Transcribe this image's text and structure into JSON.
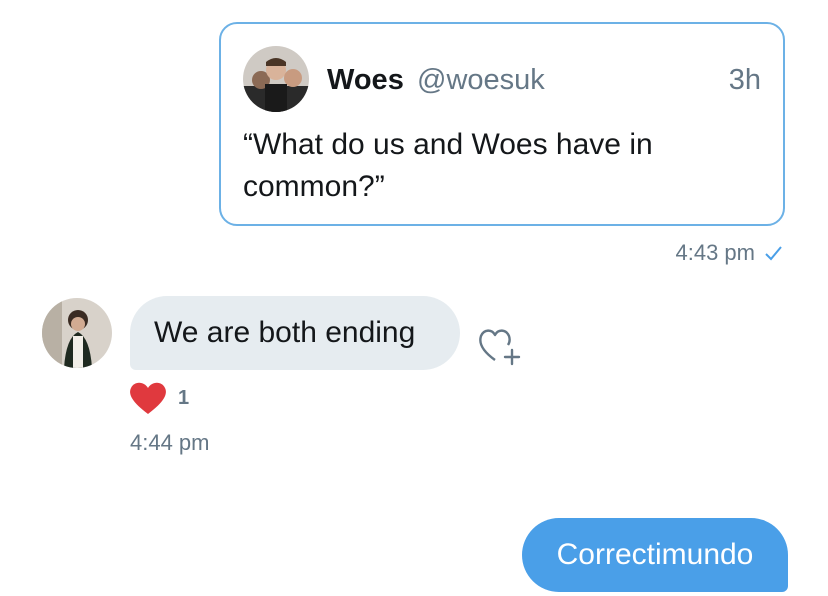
{
  "quoted_tweet": {
    "author_name": "Woes",
    "author_handle": "@woesuk",
    "time_ago": "3h",
    "text": "“What do us and Woes have in common?”",
    "avatar_icon": "group-photo-avatar"
  },
  "messages": [
    {
      "direction": "sent",
      "type": "quoted-tweet",
      "timestamp": "4:43 pm",
      "status_icon": "checkmark-icon"
    },
    {
      "direction": "received",
      "text": "We are both ending",
      "timestamp": "4:44 pm",
      "reaction": {
        "icon": "heart-icon",
        "count": "1",
        "color": "#e0245e"
      },
      "add_reaction_icon": "heart-plus-icon"
    },
    {
      "direction": "sent",
      "text": "Correctimundo"
    }
  ],
  "colors": {
    "accent": "#4a9fe8",
    "received_bubble": "#e6ecf0",
    "secondary_text": "#657786",
    "quote_border": "#6cb1e6"
  }
}
